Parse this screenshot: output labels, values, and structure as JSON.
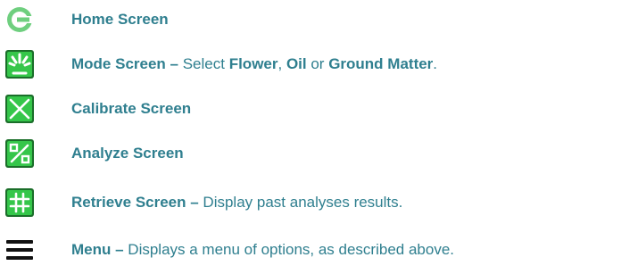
{
  "items": [
    {
      "icon": "home-icon",
      "segments": [
        {
          "text": "Home Screen",
          "bold": true
        }
      ]
    },
    {
      "icon": "mode-icon",
      "segments": [
        {
          "text": "Mode Screen –",
          "bold": true
        },
        {
          "text": " Select ",
          "bold": false
        },
        {
          "text": "Flower",
          "bold": true
        },
        {
          "text": ", ",
          "bold": false
        },
        {
          "text": "Oil",
          "bold": true
        },
        {
          "text": " or ",
          "bold": false
        },
        {
          "text": "Ground Matter",
          "bold": true
        },
        {
          "text": ".",
          "bold": false
        }
      ]
    },
    {
      "icon": "calibrate-icon",
      "segments": [
        {
          "text": "Calibrate Screen",
          "bold": true
        }
      ]
    },
    {
      "icon": "analyze-icon",
      "segments": [
        {
          "text": "Analyze Screen",
          "bold": true
        }
      ]
    },
    {
      "icon": "retrieve-icon",
      "segments": [
        {
          "text": "Retrieve Screen –",
          "bold": true
        },
        {
          "text": " Display past analyses results.",
          "bold": false
        }
      ]
    },
    {
      "icon": "menu-icon",
      "segments": [
        {
          "text": "Menu –",
          "bold": true
        },
        {
          "text": " Displays a menu of options, as described above.",
          "bold": false
        }
      ]
    }
  ],
  "colors": {
    "text": "#2f7f8f",
    "icon_green": "#35c64a",
    "icon_dark_green": "#1b6e2a",
    "menu_icon": "#111111"
  }
}
